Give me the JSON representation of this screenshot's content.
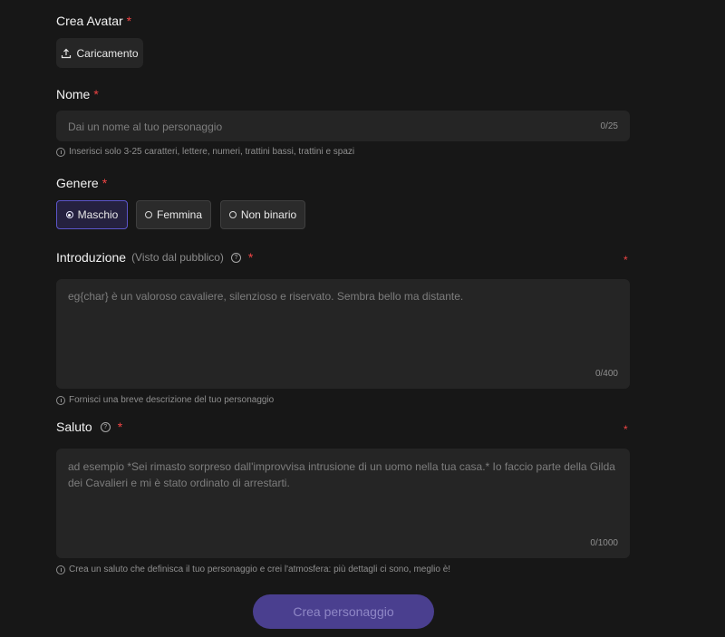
{
  "avatar": {
    "label": "Crea Avatar",
    "required": "*",
    "upload_label": "Caricamento"
  },
  "name": {
    "label": "Nome",
    "required": "*",
    "placeholder": "Dai un nome al tuo personaggio",
    "counter": "0/25",
    "hint": "Inserisci solo 3-25 caratteri, lettere, numeri, trattini bassi, trattini e spazi"
  },
  "gender": {
    "label": "Genere",
    "required": "*",
    "options": [
      "Maschio",
      "Femmina",
      "Non binario"
    ],
    "selected": "Maschio"
  },
  "intro": {
    "label": "Introduzione",
    "sublabel": "(Visto dal pubblico)",
    "required": "*",
    "placeholder": "eg{char} è un valoroso cavaliere, silenzioso e riservato. Sembra bello ma distante.",
    "counter": "0/400",
    "hint": "Fornisci una breve descrizione del tuo personaggio"
  },
  "greeting": {
    "label": "Saluto",
    "required": "*",
    "placeholder": "ad esempio *Sei rimasto sorpreso dall'improvvisa intrusione di un uomo nella tua casa.* Io faccio parte della Gilda dei Cavalieri e mi è stato ordinato di arrestarti.",
    "counter": "0/1000",
    "hint": "Crea un saluto che definisca il tuo personaggio e crei l'atmosfera: più dettagli ci sono, meglio è!"
  },
  "submit_label": "Crea personaggio",
  "colors": {
    "background": "#171717",
    "field": "#252525",
    "accent": "#5c55c9",
    "required": "#ef4444",
    "submit": "#4a3f8f"
  },
  "icons": [
    "upload-icon",
    "info-icon",
    "radio-icon",
    "help-icon"
  ]
}
